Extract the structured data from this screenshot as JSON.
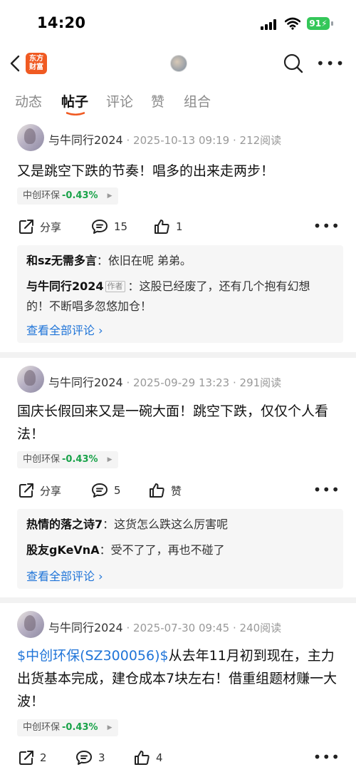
{
  "status_bar": {
    "time": "14:20",
    "battery": "91"
  },
  "header": {
    "logo_line1": "东方",
    "logo_line2": "财富"
  },
  "tabs": [
    {
      "label": "动态"
    },
    {
      "label": "帖子"
    },
    {
      "label": "评论"
    },
    {
      "label": "赞"
    },
    {
      "label": "组合"
    }
  ],
  "posts": [
    {
      "author": "与牛同行2024",
      "meta": "· 2025-10-13 09:19 · 212阅读",
      "text": "又是跳空下跌的节奏！唱多的出来走两步！",
      "tag_name": "中创环保",
      "tag_change": "-0.43%",
      "share_label": "分享",
      "comment_count": "15",
      "like_count": "1",
      "comments": [
        {
          "user": "和sz无需多言",
          "text": "：依旧在呢 弟弟。"
        },
        {
          "user": "与牛同行2024",
          "badge": "作者",
          "text": "：这股已经废了，还有几个抱有幻想的！不断唱多忽悠加仓！"
        }
      ],
      "view_all": "查看全部评论 ›"
    },
    {
      "author": "与牛同行2024",
      "meta": "· 2025-09-29 13:23 · 291阅读",
      "text": "国庆长假回来又是一碗大面！跳空下跌，仅仅个人看法！",
      "tag_name": "中创环保",
      "tag_change": "-0.43%",
      "share_label": "分享",
      "comment_count": "5",
      "like_count": "赞",
      "comments": [
        {
          "user": "热情的落之诗7",
          "text": "：这货怎么跌这么厉害呢"
        },
        {
          "user": "股友gKeVnA",
          "text": "：受不了了，再也不碰了"
        }
      ],
      "view_all": "查看全部评论 ›"
    },
    {
      "author": "与牛同行2024",
      "meta": "· 2025-07-30 09:45 · 240阅读",
      "stock_link": "$中创环保(SZ300056)$",
      "text": "从去年11月初到现在，主力出货基本完成，建仓成本7块左右！借重组题材赚一大波！",
      "tag_name": "中创环保",
      "tag_change": "-0.43%",
      "share_count": "2",
      "comment_count": "3",
      "like_count": "4"
    }
  ],
  "colors": {
    "accent_blue": "#1f74d8",
    "down_green": "#1aa34a",
    "brand_orange": "#f05a22"
  }
}
